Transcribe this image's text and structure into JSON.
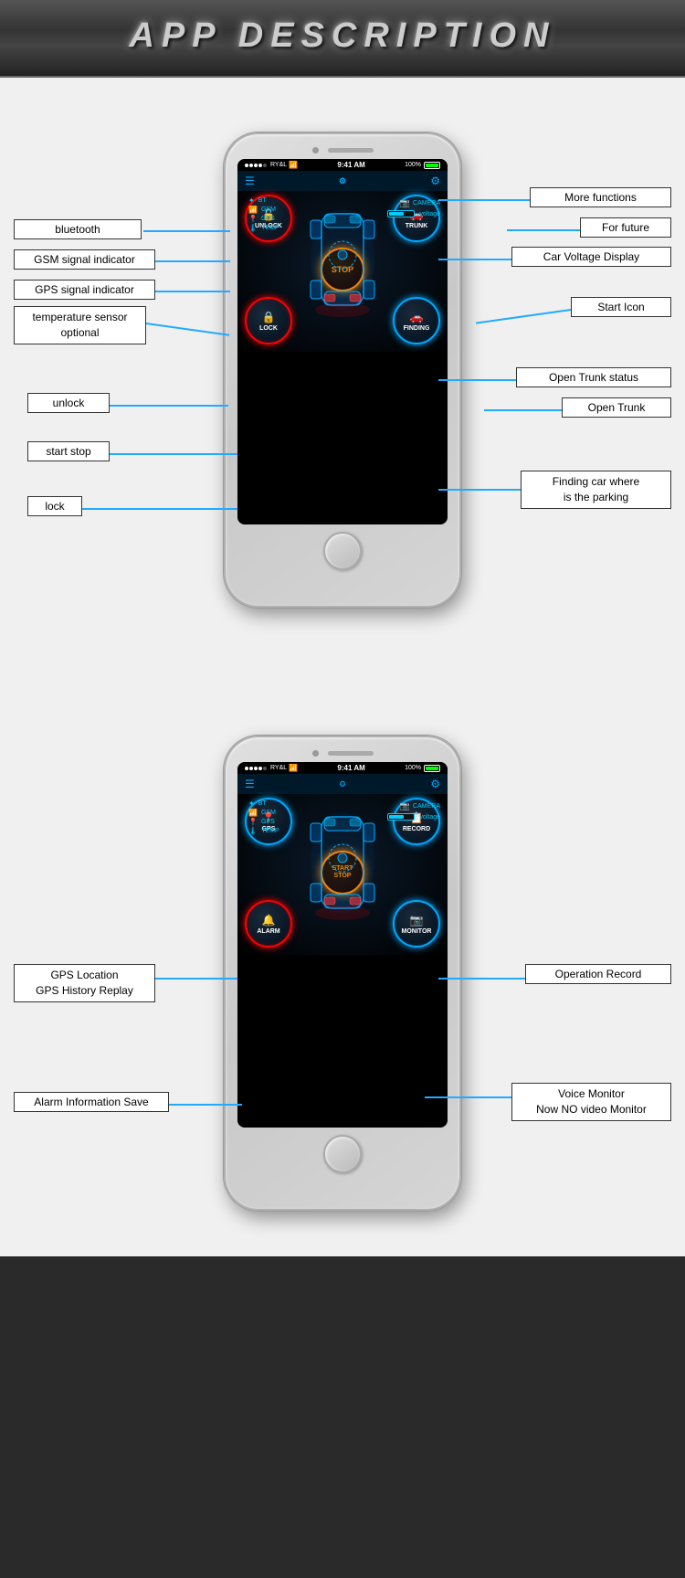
{
  "header": {
    "title": "APP  DESCRIPTION"
  },
  "section1": {
    "phone": {
      "status_bar": {
        "carrier": "RY&L",
        "time": "9:41 AM",
        "battery": "100%"
      },
      "indicators": [
        {
          "icon": "BT",
          "label": "BT"
        },
        {
          "icon": "GSM",
          "label": "GSM"
        },
        {
          "icon": "GPS",
          "label": "GPS"
        },
        {
          "icon": "TEMP",
          "label": "TEMP"
        }
      ],
      "right_indicators": [
        {
          "icon": "📷",
          "label": "CAMERA"
        },
        {
          "icon": "⚡",
          "label": "voltage"
        }
      ],
      "buttons": [
        {
          "label": "UNLOCK",
          "type": "red"
        },
        {
          "label": "TRUNK",
          "type": "blue"
        },
        {
          "label": "STOP",
          "type": "center"
        },
        {
          "label": "LOCK",
          "type": "red"
        },
        {
          "label": "FINDING",
          "type": "blue"
        }
      ]
    },
    "labels_left": [
      {
        "id": "bluetooth",
        "text": "bluetooth"
      },
      {
        "id": "gsm",
        "text": "GSM signal indicator"
      },
      {
        "id": "gps",
        "text": "GPS signal indicator"
      },
      {
        "id": "temp",
        "text": "temperature sensor\noptional"
      },
      {
        "id": "unlock",
        "text": "unlock"
      },
      {
        "id": "startstop",
        "text": "start stop"
      },
      {
        "id": "lock",
        "text": "lock"
      }
    ],
    "labels_right": [
      {
        "id": "morefunc",
        "text": "More  functions"
      },
      {
        "id": "forfuture",
        "text": "For future"
      },
      {
        "id": "voltage",
        "text": "Car Voltage Display"
      },
      {
        "id": "starticon",
        "text": "Start Icon"
      },
      {
        "id": "opentrunkstatus",
        "text": "Open Trunk status"
      },
      {
        "id": "opentrunk",
        "text": "Open Trunk"
      },
      {
        "id": "findingcar",
        "text": "Finding car where\nis the parking"
      }
    ]
  },
  "section2": {
    "phone": {
      "status_bar": {
        "carrier": "RY&L",
        "time": "9:41 AM",
        "battery": "100%"
      },
      "buttons": [
        {
          "label": "GPS",
          "type": "blue"
        },
        {
          "label": "RECORD",
          "type": "blue"
        },
        {
          "label": "START\nSTOP",
          "type": "center"
        },
        {
          "label": "ALARM",
          "type": "red"
        },
        {
          "label": "MONITOR",
          "type": "blue"
        }
      ]
    },
    "labels_left": [
      {
        "id": "gpsloc",
        "text": "GPS Location\nGPS History Replay"
      },
      {
        "id": "alarm",
        "text": "Alarm Information Save"
      }
    ],
    "labels_right": [
      {
        "id": "oprecord",
        "text": "Operation Record"
      },
      {
        "id": "voicemon",
        "text": "Voice Monitor\nNow NO video Monitor"
      }
    ]
  }
}
